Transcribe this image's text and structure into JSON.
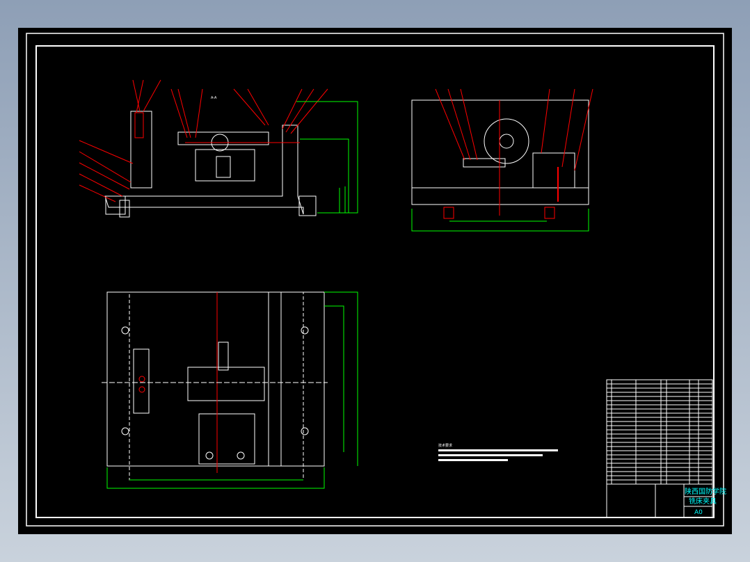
{
  "drawing": {
    "institution": "陕西国防学院",
    "title": "铣床夹具",
    "sheet_size": "A0",
    "section_label": "A-A",
    "notes_heading": "技术要求"
  },
  "colors": {
    "background": "#000000",
    "outline": "#ffffff",
    "centerline": "#ff0000",
    "dimension": "#00ff00",
    "title_text": "#00ffff",
    "hidden_line": "#0000ff"
  }
}
